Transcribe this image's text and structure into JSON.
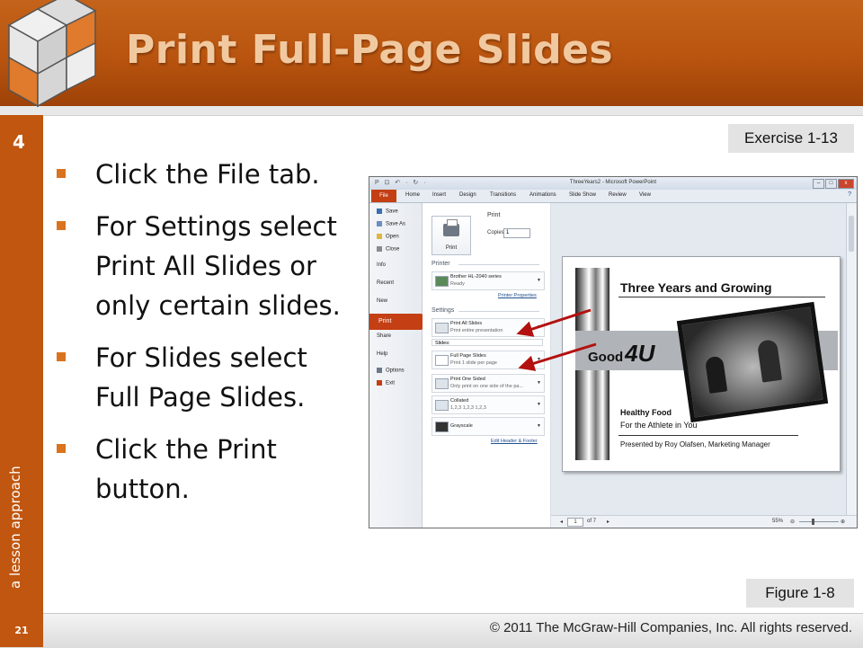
{
  "slide": {
    "title": "Print Full-Page Slides",
    "chapter": "4",
    "side_label": "a lesson approach",
    "exercise_label": "Exercise 1-13",
    "figure_label": "Figure 1-8",
    "page_number": "21",
    "copyright": "© 2011 The McGraw-Hill Companies, Inc. All rights reserved.",
    "bullets": [
      "Click the File tab.",
      "For Settings select Print All Slides or only certain slides.",
      "For Slides select Full Page Slides.",
      "Click the Print button."
    ]
  },
  "screenshot": {
    "window_title": "ThreeYears2 - Microsoft PowerPoint",
    "qat": "P ⊡ ↶ · ↻ ·",
    "win_buttons": [
      "–",
      "□",
      "x"
    ],
    "ribbon_tabs": [
      "File",
      "Home",
      "Insert",
      "Design",
      "Transitions",
      "Animations",
      "Slide Show",
      "Review",
      "View"
    ],
    "backstage_items": [
      {
        "label": "Save",
        "icon": "save-icon",
        "color": "#3a6fb0"
      },
      {
        "label": "Save As",
        "icon": "save-as-icon",
        "color": "#6a8fc0"
      },
      {
        "label": "Open",
        "icon": "open-folder-icon",
        "color": "#e0b440"
      },
      {
        "label": "Close",
        "icon": "close-doc-icon",
        "color": "#8a8a8a"
      },
      {
        "label": "Info",
        "icon": "",
        "color": ""
      },
      {
        "label": "Recent",
        "icon": "",
        "color": ""
      },
      {
        "label": "New",
        "icon": "",
        "color": ""
      },
      {
        "label": "Print",
        "icon": "",
        "color": ""
      },
      {
        "label": "Share",
        "icon": "",
        "color": ""
      },
      {
        "label": "Help",
        "icon": "",
        "color": ""
      },
      {
        "label": "Options",
        "icon": "options-icon",
        "color": "#6a7a8a"
      },
      {
        "label": "Exit",
        "icon": "exit-icon",
        "color": "#c43f14"
      }
    ],
    "print": {
      "section": "Print",
      "button_label": "Print",
      "copies_label": "Copies:",
      "copies_value": "1"
    },
    "printer": {
      "header": "Printer",
      "name": "Brother HL-2040 series",
      "status": "Ready",
      "properties_link": "Printer Properties"
    },
    "settings": {
      "header": "Settings",
      "print_all": {
        "title": "Print All Slides",
        "desc": "Print entire presentation"
      },
      "slides_label": "Slides:",
      "full_page": {
        "title": "Full Page Slides",
        "desc": "Print 1 slide per page"
      },
      "one_sided": {
        "title": "Print One Sided",
        "desc": "Only print on one side of the pa..."
      },
      "collated": {
        "title": "Collated",
        "desc": "1,2,3    1,2,3    1,2,3"
      },
      "grayscale": {
        "title": "Grayscale"
      },
      "edit_link": "Edit Header & Footer"
    },
    "status": {
      "page": "1",
      "of": "of 7",
      "zoom": "55%"
    },
    "preview_slide": {
      "title": "Three Years and Growing",
      "brand_small": "Good",
      "brand_big": "4U",
      "line1": "Healthy Food",
      "line2": "For the Athlete in You",
      "presented": "Presented by Roy Olafsen, Marketing Manager"
    }
  }
}
